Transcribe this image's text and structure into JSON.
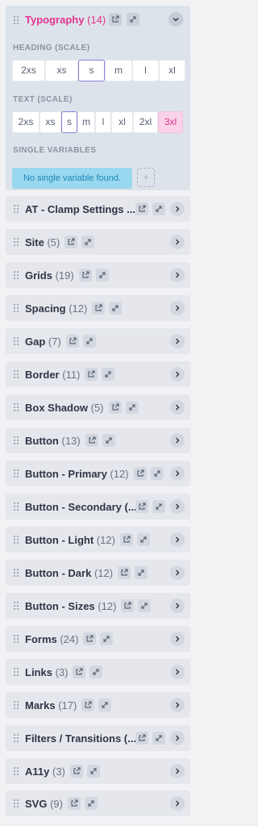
{
  "colors": {
    "accent_pink": "#e5338f",
    "selection": "#8d7ed8",
    "info_bg": "#9ad8f0"
  },
  "panel": {
    "title": "Typography",
    "count": "(14)",
    "heading_label": "HEADING (SCALE)",
    "heading_options": [
      "2xs",
      "xs",
      "s",
      "m",
      "l",
      "xl"
    ],
    "heading_selected": "s",
    "text_label": "TEXT (SCALE)",
    "text_options": [
      "2xs",
      "xs",
      "s",
      "m",
      "l",
      "xl",
      "2xl",
      "3xl"
    ],
    "text_selected": "s",
    "text_highlighted": "3xl",
    "single_label": "SINGLE VARIABLES",
    "empty_message": "No single variable found.",
    "add_label": "+"
  },
  "groups": [
    {
      "name": "AT - Clamp Settings ...",
      "count": ""
    },
    {
      "name": "Site",
      "count": "(5)"
    },
    {
      "name": "Grids",
      "count": "(19)"
    },
    {
      "name": "Spacing",
      "count": "(12)"
    },
    {
      "name": "Gap",
      "count": "(7)"
    },
    {
      "name": "Border",
      "count": "(11)"
    },
    {
      "name": "Box Shadow",
      "count": "(5)"
    },
    {
      "name": "Button",
      "count": "(13)"
    },
    {
      "name": "Button - Primary",
      "count": "(12)"
    },
    {
      "name": "Button - Secondary (...",
      "count": ""
    },
    {
      "name": "Button - Light",
      "count": "(12)"
    },
    {
      "name": "Button - Dark",
      "count": "(12)"
    },
    {
      "name": "Button - Sizes",
      "count": "(12)"
    },
    {
      "name": "Forms",
      "count": "(24)"
    },
    {
      "name": "Links",
      "count": "(3)"
    },
    {
      "name": "Marks",
      "count": "(17)"
    },
    {
      "name": "Filters / Transitions (...",
      "count": ""
    },
    {
      "name": "A11y",
      "count": "(3)"
    },
    {
      "name": "SVG",
      "count": "(9)"
    }
  ]
}
